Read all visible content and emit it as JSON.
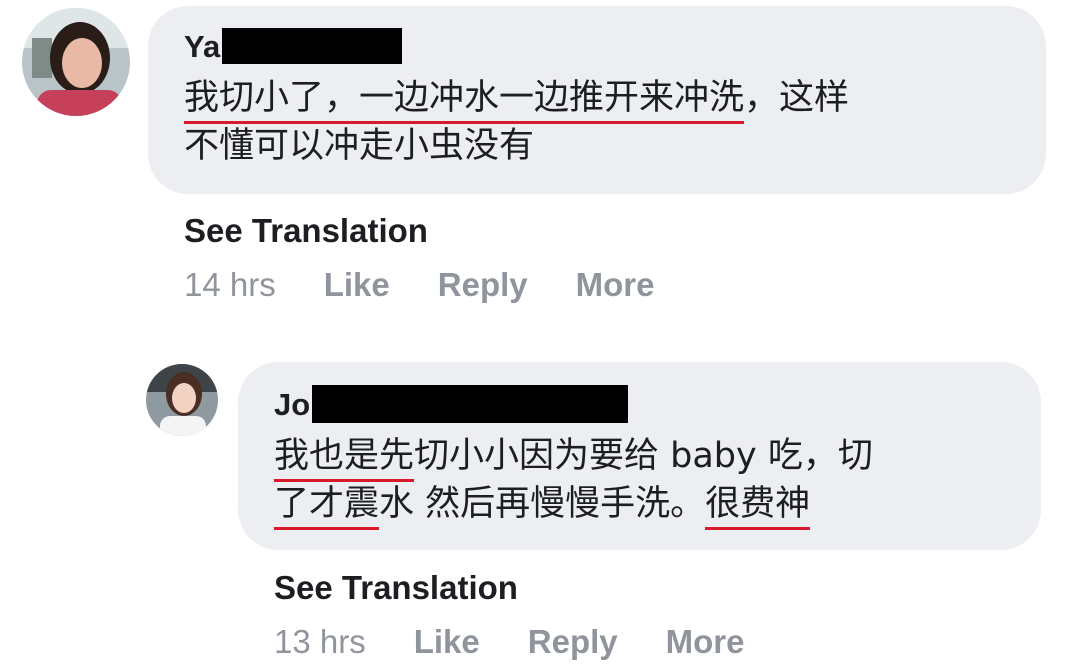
{
  "comments": [
    {
      "author_visible": "Ya",
      "text_line1_ul1": "我切小了，一边冲",
      "text_line1_ul2": "水一边推开来冲洗",
      "text_line1_rest": "，这样",
      "text_line2": "不懂可以冲走小虫没有",
      "see_translation": "See Translation",
      "time": "14 hrs",
      "like": "Like",
      "reply": "Reply",
      "more": "More"
    },
    {
      "author_visible": "Jo",
      "text_line1_ul": "我也是先",
      "text_line1_rest": "切小小因为要给 baby 吃，切",
      "text_line2_ul": "了才震",
      "text_line2_mid": "水 然后再慢慢手洗。",
      "text_line2_ul2": "很费神",
      "see_translation": "See Translation",
      "time": "13 hrs",
      "like": "Like",
      "reply": "Reply",
      "more": "More"
    }
  ]
}
